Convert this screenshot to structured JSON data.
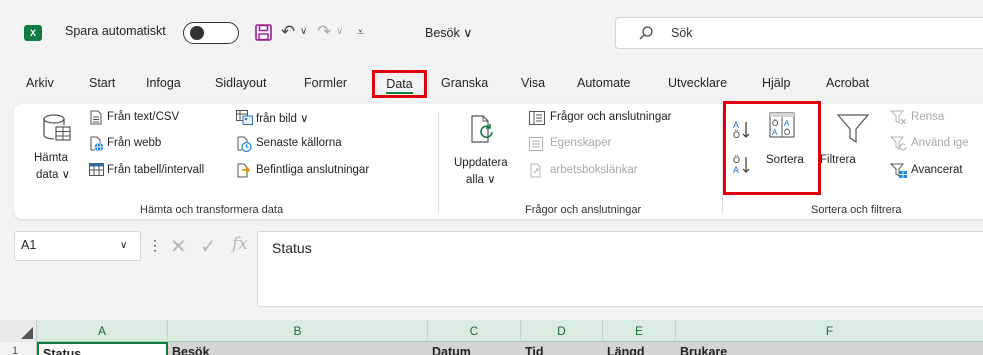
{
  "titlebar": {
    "app_icon": "excel-icon",
    "app_badge": "X",
    "autosave_label": "Spara automatiskt",
    "doc_name": "Besök ∨",
    "search_placeholder": "Sök"
  },
  "tabs": [
    "Arkiv",
    "Start",
    "Infoga",
    "Sidlayout",
    "Formler",
    "Data",
    "Granska",
    "Visa",
    "Automate",
    "Utvecklare",
    "Hjälp",
    "Acrobat"
  ],
  "active_tab": "Data",
  "ribbon": {
    "get_data": {
      "hamta_line1": "Hämta",
      "hamta_line2": "data ∨",
      "from_text": "Från text/CSV",
      "from_web": "Från webb",
      "from_table": "Från tabell/intervall",
      "from_picture": "från bild ∨",
      "recent_sources": "Senaste källorna",
      "existing_connections": "Befintliga anslutningar",
      "label": "Hämta och transformera data"
    },
    "queries": {
      "refresh_line1": "Uppdatera",
      "refresh_line2": "alla ∨",
      "queries_connections": "Frågor och anslutningar",
      "properties": "Egenskaper",
      "workbook_links": "arbetsbokslänkar",
      "label": "Frågor och anslutningar"
    },
    "sort_filter": {
      "sort": "Sortera",
      "filter": "Filtrera",
      "clear": "Rensa",
      "reapply": "Använd ige",
      "advanced": "Avancerat",
      "label": "Sortera och filtrera"
    }
  },
  "formula_bar": {
    "name_box": "A1",
    "fx": "fx",
    "content": "Status"
  },
  "grid": {
    "columns": [
      "A",
      "B",
      "C",
      "D",
      "E",
      "F"
    ],
    "row_number": "1",
    "row1": [
      "Status",
      "Besök",
      "Datum",
      "Tid",
      "Längd",
      "Brukare"
    ]
  },
  "colors": {
    "highlight": "#e3000f",
    "excel_green": "#107c41"
  }
}
